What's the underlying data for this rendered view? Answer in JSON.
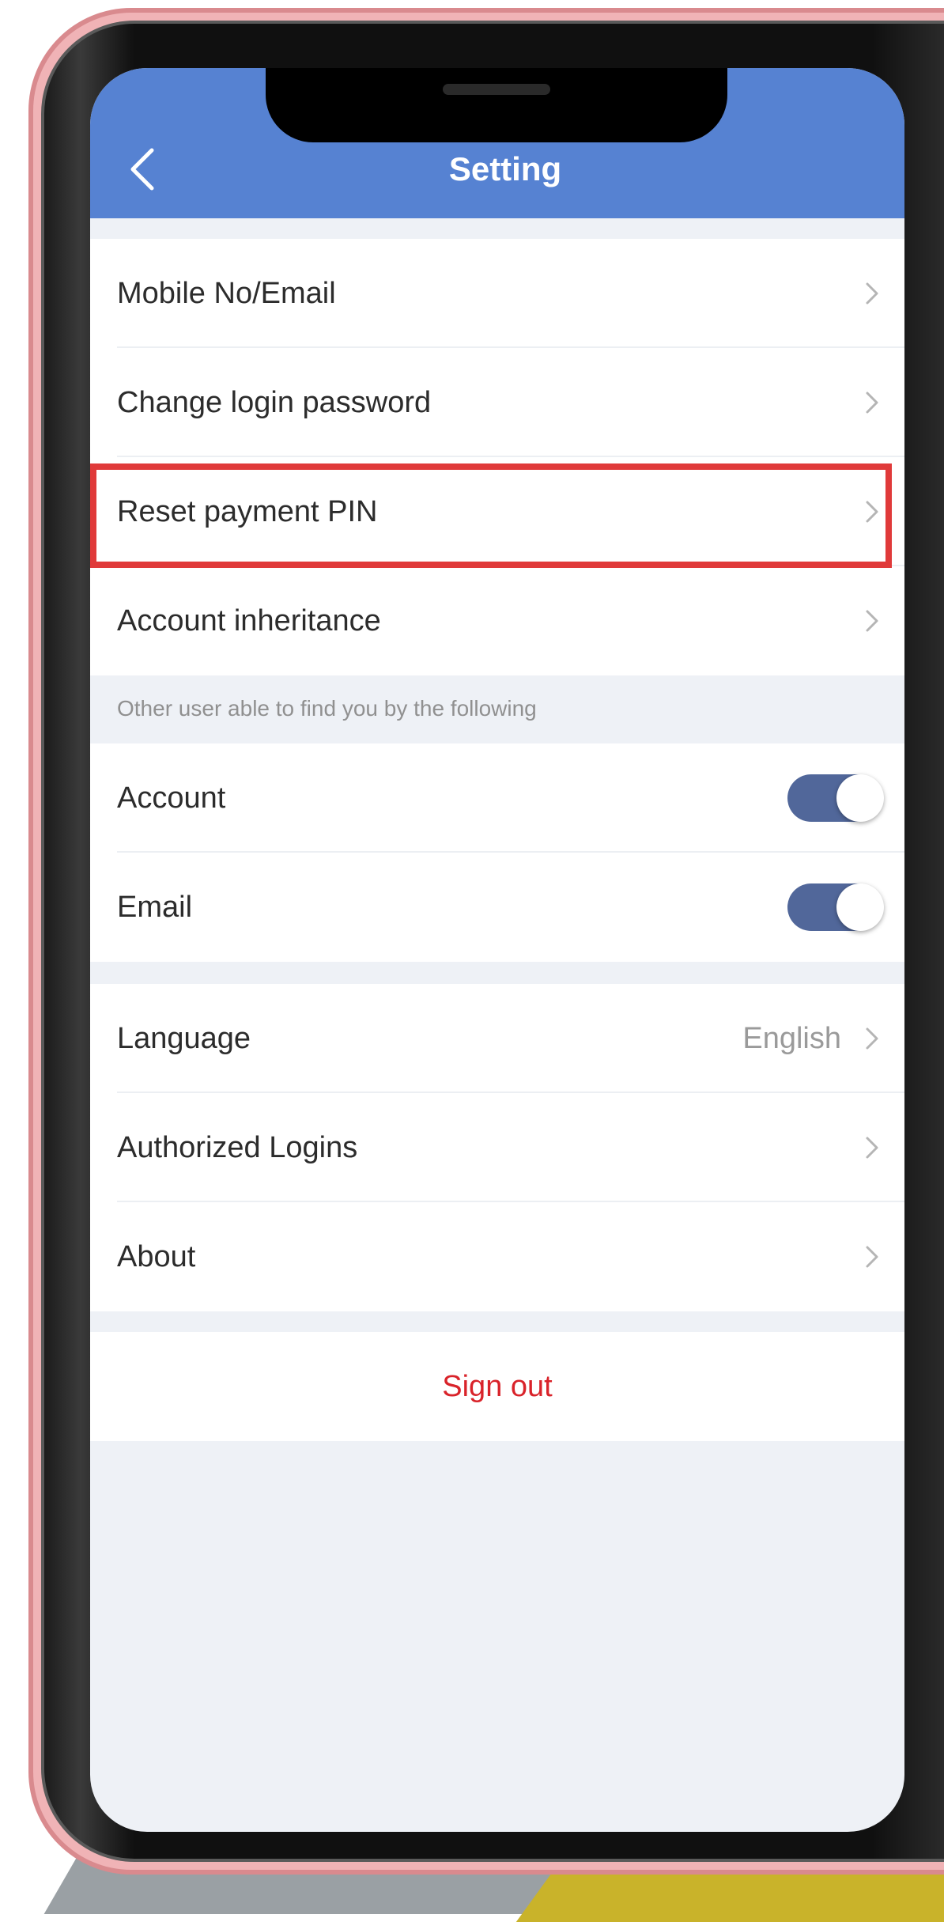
{
  "header": {
    "title": "Setting",
    "back_icon": "chevron-left-icon"
  },
  "account_group": {
    "items": [
      {
        "label": "Mobile No/Email",
        "icon": "chevron-right-icon"
      },
      {
        "label": "Change login password",
        "icon": "chevron-right-icon"
      },
      {
        "label": "Reset payment PIN",
        "icon": "chevron-right-icon",
        "highlighted": true
      },
      {
        "label": "Account inheritance",
        "icon": "chevron-right-icon"
      }
    ]
  },
  "discovery": {
    "note": "Other user able to find you by the following",
    "items": [
      {
        "label": "Account",
        "enabled": true
      },
      {
        "label": "Email",
        "enabled": true
      }
    ]
  },
  "general_group": {
    "items": [
      {
        "label": "Language",
        "value": "English",
        "icon": "chevron-right-icon"
      },
      {
        "label": "Authorized Logins",
        "icon": "chevron-right-icon"
      },
      {
        "label": "About",
        "icon": "chevron-right-icon"
      }
    ]
  },
  "signout": {
    "label": "Sign out"
  },
  "colors": {
    "header_bg": "#5682d2",
    "screen_bg": "#eef1f6",
    "highlight": "#e03a3a",
    "toggle_on": "#51679a",
    "signout_text": "#d9232a"
  }
}
